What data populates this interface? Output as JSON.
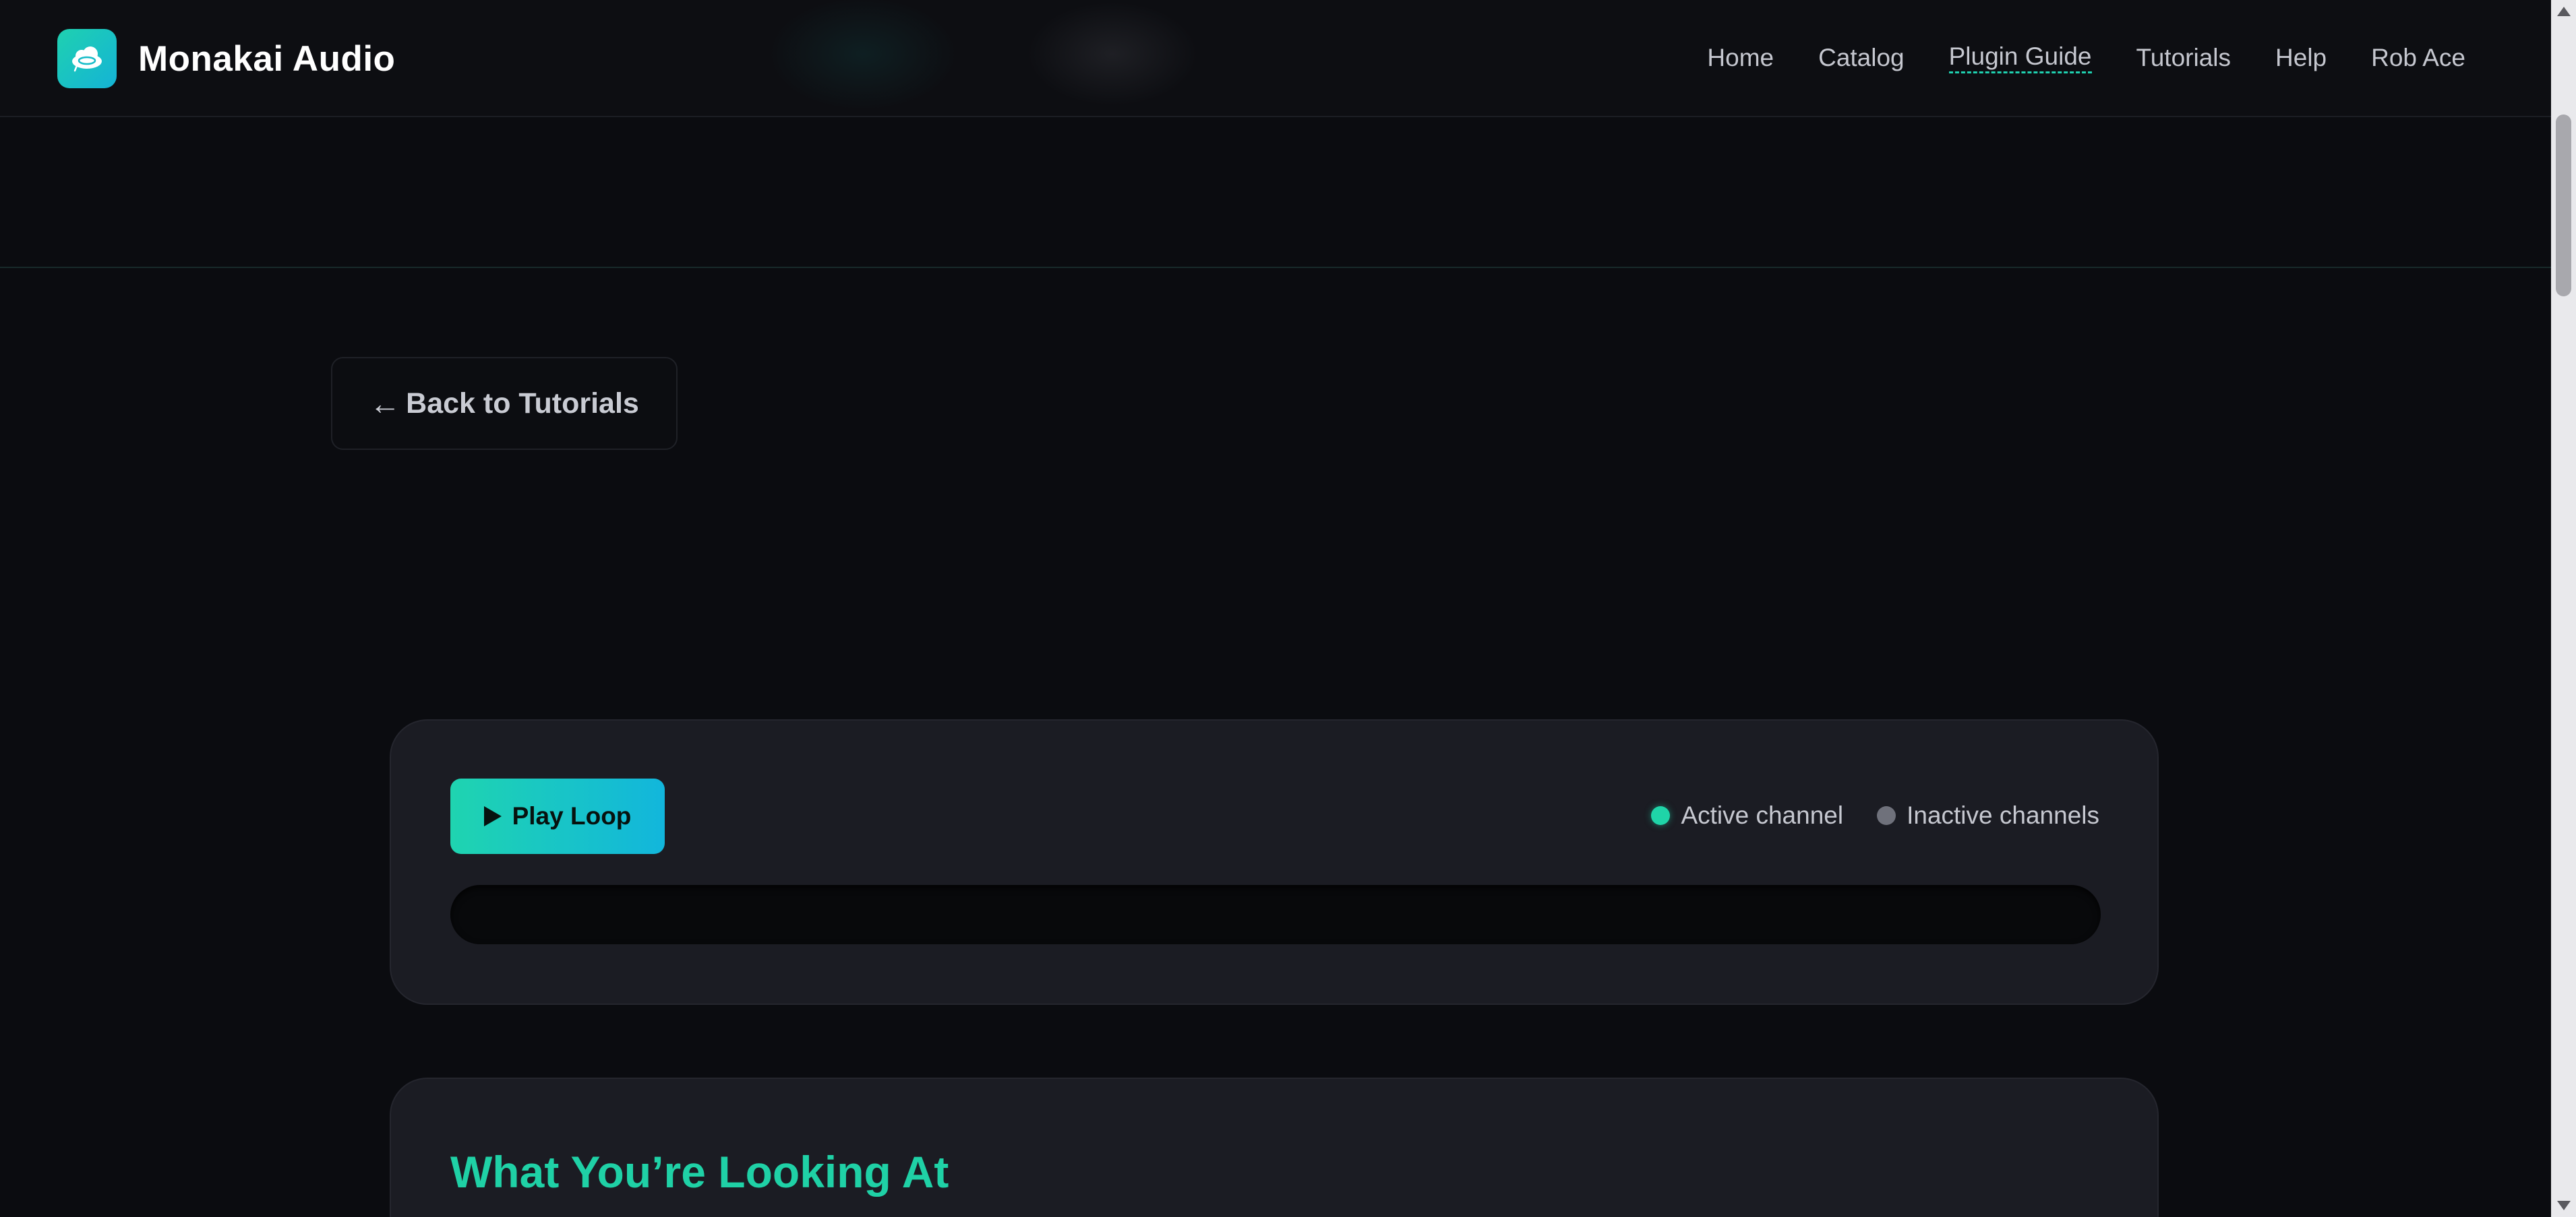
{
  "header": {
    "brand_name": "Monakai Audio",
    "nav": [
      {
        "label": "Home"
      },
      {
        "label": "Catalog"
      },
      {
        "label": "Plugin Guide",
        "active": true
      },
      {
        "label": "Tutorials"
      },
      {
        "label": "Help"
      },
      {
        "label": "Rob Ace"
      }
    ]
  },
  "back": {
    "arrow": "←",
    "label": "Back to Tutorials"
  },
  "player": {
    "play_label": "Play Loop",
    "legend": {
      "active": "Active channel",
      "inactive": "Inactive channels"
    }
  },
  "info": {
    "title": "What You’re Looking At"
  },
  "colors": {
    "accent": "#1fd1a6",
    "accent_gradient_end": "#12b6dc",
    "background": "#0b0c10",
    "card": "#1b1c23",
    "inactive_dot": "#6f717b"
  },
  "icons": {
    "logo": "cloud-vinyl-icon",
    "play": "play-icon"
  }
}
